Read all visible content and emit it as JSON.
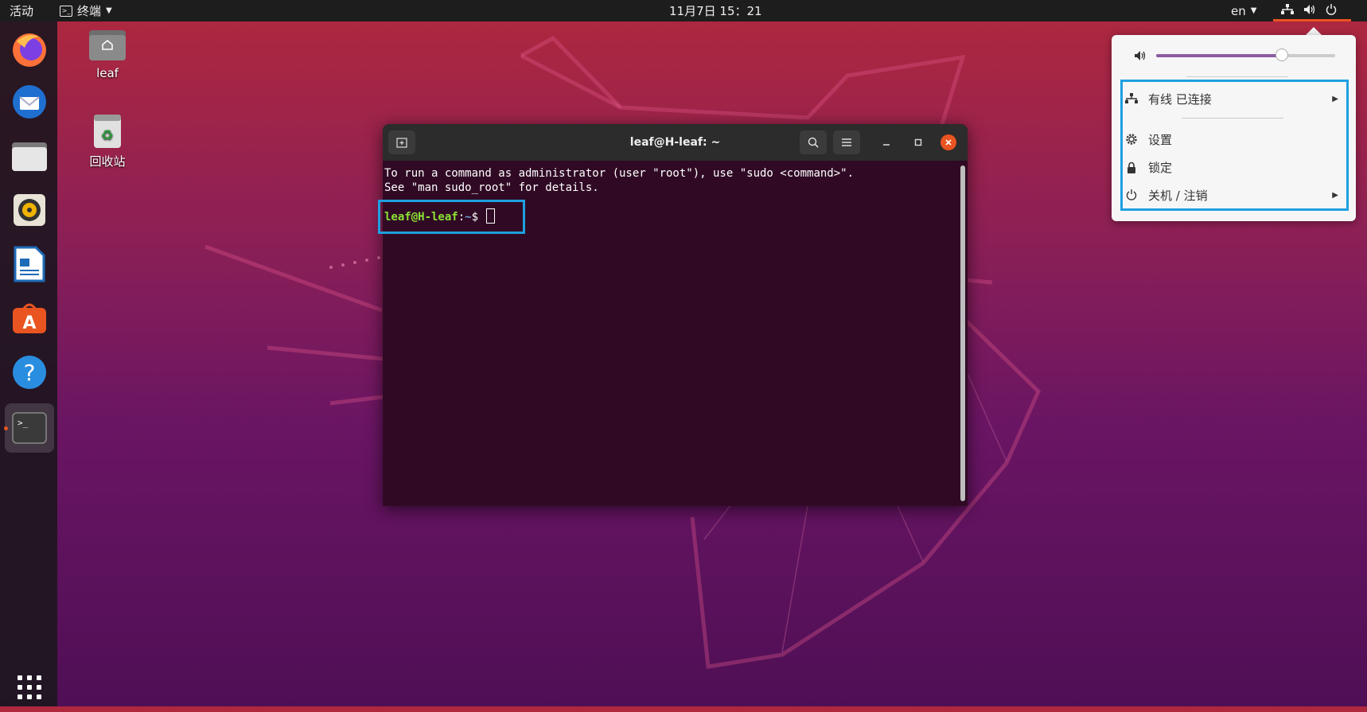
{
  "topbar": {
    "activities": "活动",
    "app_menu": "终端",
    "clock": "11月7日  15：21",
    "lang": "en"
  },
  "desktop": {
    "home_label": "leaf",
    "trash_label": "回收站"
  },
  "dock": {
    "items": [
      "firefox-icon",
      "thunderbird-icon",
      "files-icon",
      "rhythmbox-icon",
      "writer-icon",
      "software-icon",
      "help-icon",
      "terminal-icon"
    ],
    "apps_grid": "show-applications-icon"
  },
  "terminal": {
    "title": "leaf@H-leaf: ~",
    "line1": "To run a command as administrator (user \"root\"), use \"sudo <command>\".",
    "line2": "See \"man sudo_root\" for details.",
    "prompt_user": "leaf@H-leaf",
    "prompt_sep": ":",
    "prompt_path": "~",
    "prompt_symbol": "$ "
  },
  "system_menu": {
    "volume_level": 0.7,
    "wired": "有线 已连接",
    "settings": "设置",
    "lock": "锁定",
    "power": "关机 / 注销"
  },
  "colors": {
    "accent_highlight": "#1ea0e0",
    "prompt_green": "#8ae234",
    "terminal_bg": "#300a24",
    "slider_fill": "#8c5ba0"
  }
}
